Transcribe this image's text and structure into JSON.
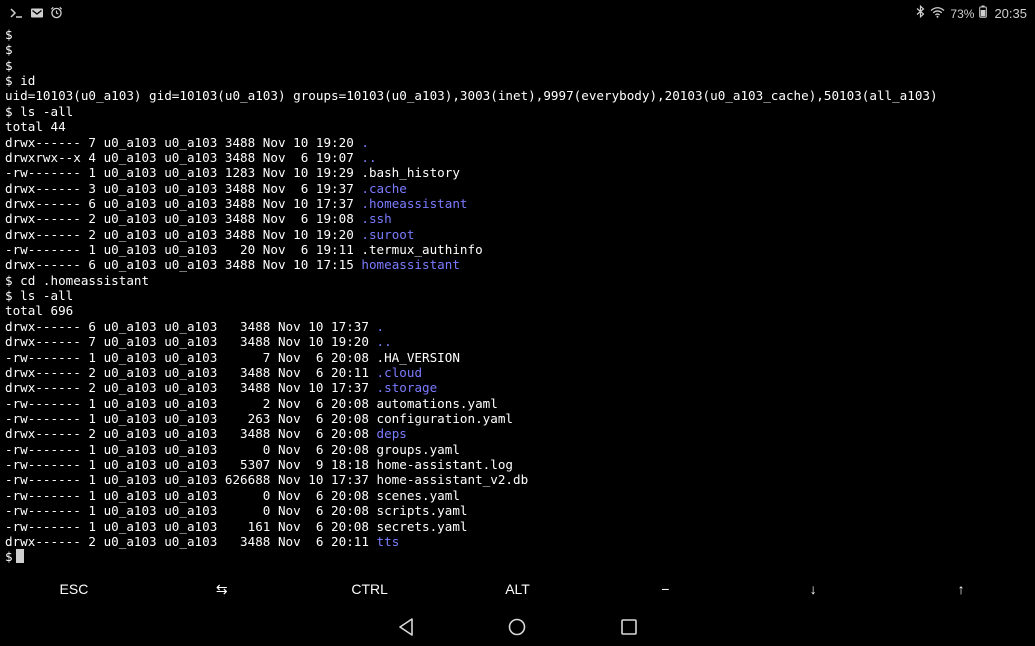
{
  "status_bar": {
    "left_icons": [
      "terminal-icon",
      "mail-icon",
      "alarm-icon"
    ],
    "right_icons": [
      "bluetooth-icon",
      "wifi-icon"
    ],
    "battery": "73%",
    "time": "20:35"
  },
  "terminal": {
    "lines": [
      [
        {
          "t": "$"
        }
      ],
      [
        {
          "t": "$"
        }
      ],
      [
        {
          "t": "$"
        }
      ],
      [
        {
          "t": "$ id"
        }
      ],
      [
        {
          "t": "uid=10103(u0_a103) gid=10103(u0_a103) groups=10103(u0_a103),3003(inet),9997(everybody),20103(u0_a103_cache),50103(all_a103)"
        }
      ],
      [
        {
          "t": "$ ls -all"
        }
      ],
      [
        {
          "t": "total 44"
        }
      ],
      [
        {
          "t": "drwx------ 7 u0_a103 u0_a103 3488 Nov 10 19:20 "
        },
        {
          "t": ".",
          "c": "dir"
        }
      ],
      [
        {
          "t": "drwxrwx--x 4 u0_a103 u0_a103 3488 Nov  6 19:07 "
        },
        {
          "t": "..",
          "c": "dir"
        }
      ],
      [
        {
          "t": "-rw------- 1 u0_a103 u0_a103 1283 Nov 10 19:29 .bash_history"
        }
      ],
      [
        {
          "t": "drwx------ 3 u0_a103 u0_a103 3488 Nov  6 19:37 "
        },
        {
          "t": ".cache",
          "c": "dir"
        }
      ],
      [
        {
          "t": "drwx------ 6 u0_a103 u0_a103 3488 Nov 10 17:37 "
        },
        {
          "t": ".homeassistant",
          "c": "dir"
        }
      ],
      [
        {
          "t": "drwx------ 2 u0_a103 u0_a103 3488 Nov  6 19:08 "
        },
        {
          "t": ".ssh",
          "c": "dir"
        }
      ],
      [
        {
          "t": "drwx------ 2 u0_a103 u0_a103 3488 Nov 10 19:20 "
        },
        {
          "t": ".suroot",
          "c": "dir"
        }
      ],
      [
        {
          "t": "-rw------- 1 u0_a103 u0_a103   20 Nov  6 19:11 .termux_authinfo"
        }
      ],
      [
        {
          "t": "drwx------ 6 u0_a103 u0_a103 3488 Nov 10 17:15 "
        },
        {
          "t": "homeassistant",
          "c": "dir"
        }
      ],
      [
        {
          "t": "$ cd .homeassistant"
        }
      ],
      [
        {
          "t": "$ ls -all"
        }
      ],
      [
        {
          "t": "total 696"
        }
      ],
      [
        {
          "t": "drwx------ 6 u0_a103 u0_a103   3488 Nov 10 17:37 "
        },
        {
          "t": ".",
          "c": "dir"
        }
      ],
      [
        {
          "t": "drwx------ 7 u0_a103 u0_a103   3488 Nov 10 19:20 "
        },
        {
          "t": "..",
          "c": "dir"
        }
      ],
      [
        {
          "t": "-rw------- 1 u0_a103 u0_a103      7 Nov  6 20:08 .HA_VERSION"
        }
      ],
      [
        {
          "t": "drwx------ 2 u0_a103 u0_a103   3488 Nov  6 20:11 "
        },
        {
          "t": ".cloud",
          "c": "dir"
        }
      ],
      [
        {
          "t": "drwx------ 2 u0_a103 u0_a103   3488 Nov 10 17:37 "
        },
        {
          "t": ".storage",
          "c": "dir"
        }
      ],
      [
        {
          "t": "-rw------- 1 u0_a103 u0_a103      2 Nov  6 20:08 automations.yaml"
        }
      ],
      [
        {
          "t": "-rw------- 1 u0_a103 u0_a103    263 Nov  6 20:08 configuration.yaml"
        }
      ],
      [
        {
          "t": "drwx------ 2 u0_a103 u0_a103   3488 Nov  6 20:08 "
        },
        {
          "t": "deps",
          "c": "dir"
        }
      ],
      [
        {
          "t": "-rw------- 1 u0_a103 u0_a103      0 Nov  6 20:08 groups.yaml"
        }
      ],
      [
        {
          "t": "-rw------- 1 u0_a103 u0_a103   5307 Nov  9 18:18 home-assistant.log"
        }
      ],
      [
        {
          "t": "-rw------- 1 u0_a103 u0_a103 626688 Nov 10 17:37 home-assistant_v2.db"
        }
      ],
      [
        {
          "t": "-rw------- 1 u0_a103 u0_a103      0 Nov  6 20:08 scenes.yaml"
        }
      ],
      [
        {
          "t": "-rw------- 1 u0_a103 u0_a103      0 Nov  6 20:08 scripts.yaml"
        }
      ],
      [
        {
          "t": "-rw------- 1 u0_a103 u0_a103    161 Nov  6 20:08 secrets.yaml"
        }
      ],
      [
        {
          "t": "drwx------ 2 u0_a103 u0_a103   3488 Nov  6 20:11 "
        },
        {
          "t": "tts",
          "c": "dir"
        }
      ]
    ],
    "prompt": "$",
    "colors": {
      "dir": "#7b7bff",
      "text": "#ffffff",
      "background": "#000000"
    }
  },
  "extra_keys": [
    {
      "label": "ESC",
      "name": "esc-key"
    },
    {
      "label": "⇆",
      "name": "tab-key"
    },
    {
      "label": "CTRL",
      "name": "ctrl-key"
    },
    {
      "label": "ALT",
      "name": "alt-key"
    },
    {
      "label": "−",
      "name": "dash-key"
    },
    {
      "label": "↓",
      "name": "arrow-down-key"
    },
    {
      "label": "↑",
      "name": "arrow-up-key"
    }
  ],
  "nav_bar": [
    "back-icon",
    "home-icon",
    "recents-icon"
  ]
}
